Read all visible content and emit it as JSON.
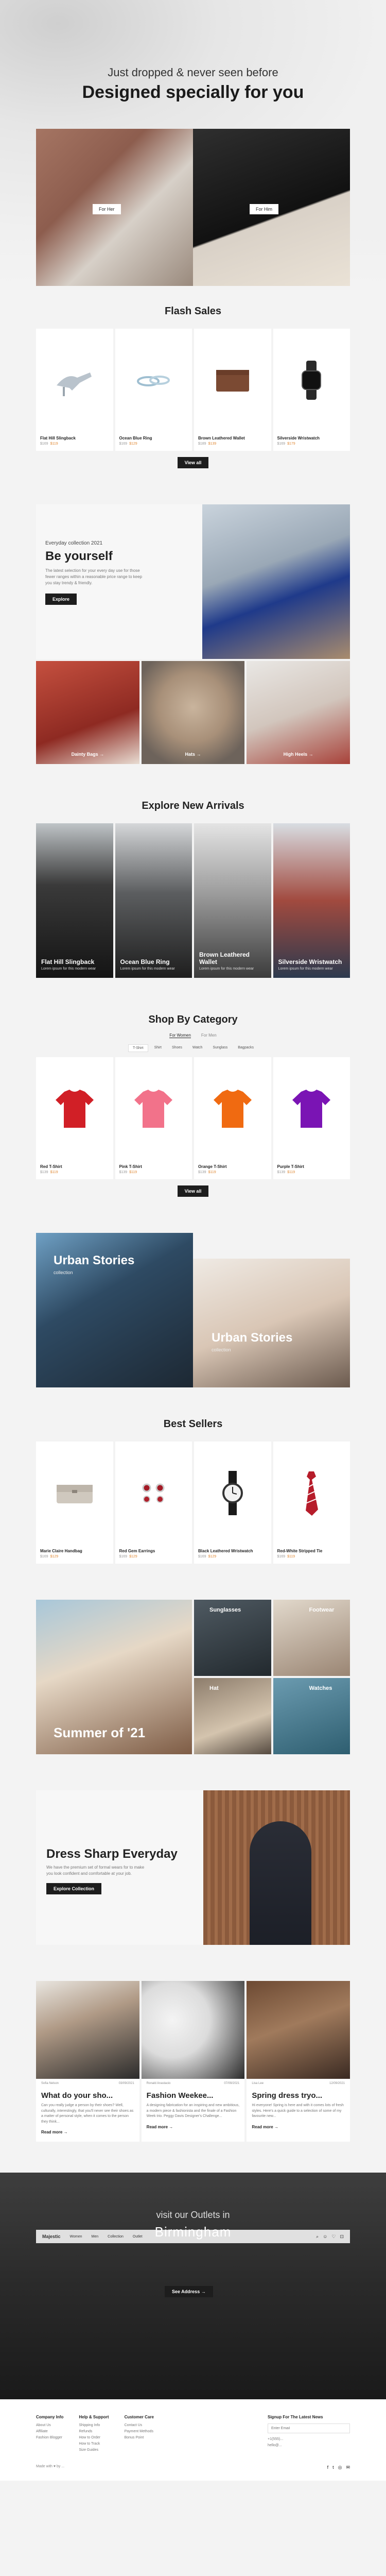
{
  "hero": {
    "subtitle": "Just dropped & never seen before",
    "title": "Designed specially for you",
    "for_her": "For Her",
    "for_him": "For Him"
  },
  "flash": {
    "title": "Flash Sales",
    "products": [
      {
        "name": "Flat Hill Slingback",
        "price": "$169",
        "sale": "$119"
      },
      {
        "name": "Ocean Blue Ring",
        "price": "$169",
        "sale": "$129"
      },
      {
        "name": "Brown Leathered Wallet",
        "price": "$189",
        "sale": "$139"
      },
      {
        "name": "Silverside Wristwatch",
        "price": "$169",
        "sale": "$179"
      }
    ],
    "view_all": "View all"
  },
  "everyday": {
    "kicker": "Everyday collection 2021",
    "title": "Be yourself",
    "desc": "The latest selection for your every day use for those fewer ranges within a reasonable price range to keep you stay trendy & friendly.",
    "button": "Explore",
    "tiles": [
      "Dainty Bags →",
      "Hats →",
      "High Heels →"
    ]
  },
  "arrivals": {
    "title": "Explore New Arrivals",
    "items": [
      {
        "name": "Flat Hill Slingback",
        "desc": "Lorem ipsum for this modern wear"
      },
      {
        "name": "Ocean Blue Ring",
        "desc": "Lorem ipsum for this modern wear"
      },
      {
        "name": "Brown Leathered Wallet",
        "desc": "Lorem ipsum for this modern wear"
      },
      {
        "name": "Silverside Wristwatch",
        "desc": "Lorem ipsum for this modern wear"
      }
    ]
  },
  "category": {
    "title": "Shop By Category",
    "tabs": [
      "For Women",
      "For Men"
    ],
    "chips": [
      "T-Shirt",
      "Shirt",
      "Shoes",
      "Watch",
      "Sunglass",
      "Bagpacks"
    ],
    "products": [
      {
        "name": "Red T-Shirt",
        "price": "$139",
        "sale": "$119"
      },
      {
        "name": "Pink T-Shirt",
        "price": "$139",
        "sale": "$119"
      },
      {
        "name": "Orange T-Shirt",
        "price": "$139",
        "sale": "$119"
      },
      {
        "name": "Purple T-Shirt",
        "price": "$139",
        "sale": "$119"
      }
    ],
    "view_all": "View all"
  },
  "urban": {
    "left_title": "Urban Stories",
    "left_sub": "collection",
    "right_title": "Urban Stories",
    "right_sub": "collection"
  },
  "bestsellers": {
    "title": "Best Sellers",
    "products": [
      {
        "name": "Marie Claire Handbag",
        "price": "$169",
        "sale": "$129"
      },
      {
        "name": "Red Gem Earrings",
        "price": "$169",
        "sale": "$129"
      },
      {
        "name": "Black Leathered Wristwatch",
        "price": "$169",
        "sale": "$129"
      },
      {
        "name": "Red-White Stripped Tie",
        "price": "$169",
        "sale": "$119"
      }
    ]
  },
  "summer": {
    "title": "Summer of '21",
    "minis": [
      "Sunglasses",
      "Footwear",
      "Hat",
      "Watches"
    ]
  },
  "dress": {
    "title": "Dress Sharp Everyday",
    "desc": "We have the premium set of formal wears for to make you look confident and comfortable at your job.",
    "button": "Explore Collection"
  },
  "blog": {
    "posts": [
      {
        "title": "What do your sho...",
        "text": "Can you really judge a person by their shoes? Well, culturally, interestingly, that you'll never see their shoes as a matter of personal style, when it comes to the person they think...",
        "more": "Read more →",
        "author": "Sofia Nelson",
        "date": "03/09/2021"
      },
      {
        "title": "Fashion Weekee...",
        "text": "A designing fabrication for an inspiring and new ambitious, a modern piece & fashionista and the finale of a Fashion Week trio. Peggy Davis Designer's Challenge...",
        "more": "Read more →",
        "author": "Ronald Anastacio",
        "date": "07/09/2021"
      },
      {
        "title": "Spring dress tryo...",
        "text": "Hi everyone! Spring is here and with it comes lots of fresh styles. Here's a quick guide to a selection of some of my favourite new...",
        "more": "Read more →",
        "author": "Lisa Lee",
        "date": "12/09/2021"
      }
    ]
  },
  "outlet": {
    "visit": "visit our Outlets in",
    "city": "Birmingham",
    "button": "See Address →",
    "nav": [
      "Women",
      "Men",
      "Collection",
      "Outlet"
    ],
    "logo": "Majestic"
  },
  "footer": {
    "cols": [
      {
        "title": "Company Info",
        "items": [
          "About Us",
          "Affiliate",
          "Fashion Blogger"
        ]
      },
      {
        "title": "Help & Support",
        "items": [
          "Shipping Info",
          "Refunds",
          "How to Order",
          "How to Track",
          "Size Guides"
        ]
      },
      {
        "title": "Customer Care",
        "items": [
          "Contact Us",
          "Payment Methods",
          "Bonus Point"
        ]
      }
    ],
    "newsletter_title": "Signup For The Latest News",
    "newsletter_placeholder": "Enter Email",
    "phone": "+1(555)...",
    "email": "hello@...",
    "made_with": "Made with ♥ by ..."
  }
}
